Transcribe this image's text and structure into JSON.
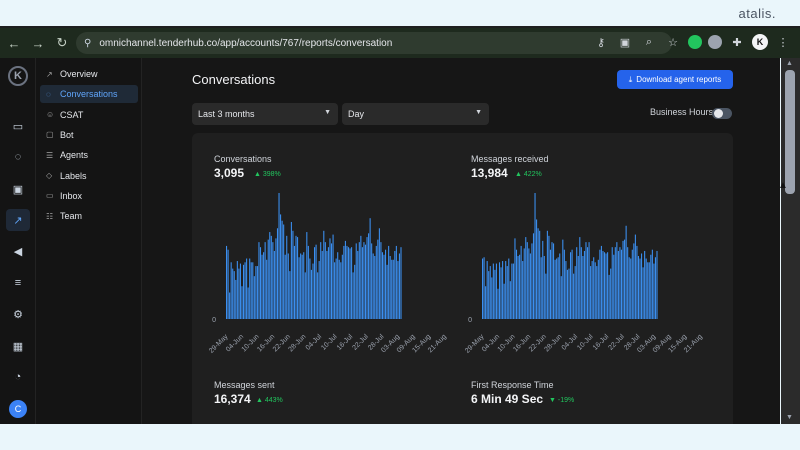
{
  "browser": {
    "brand_text": "atalis.",
    "url": "omnichannel.tenderhub.co/app/accounts/767/reports/conversation",
    "avatar_letter": "K"
  },
  "rail": {
    "logo_letter": "K",
    "avatar_letter": "C",
    "items": [
      {
        "name": "inbox-icon",
        "glyph": "▭"
      },
      {
        "name": "chat-icon",
        "glyph": "◌"
      },
      {
        "name": "contacts-icon",
        "glyph": "▣"
      },
      {
        "name": "reports-icon",
        "glyph": "↗"
      },
      {
        "name": "campaigns-icon",
        "glyph": "◀"
      },
      {
        "name": "library-icon",
        "glyph": "≡"
      },
      {
        "name": "settings-icon",
        "glyph": "⚙"
      },
      {
        "name": "integrations-icon",
        "glyph": "▦"
      },
      {
        "name": "notifications-icon",
        "glyph": "◔"
      }
    ]
  },
  "sidebar": {
    "items": [
      {
        "label": "Overview",
        "icon": "overview-icon",
        "glyph": "↗"
      },
      {
        "label": "Conversations",
        "icon": "conversations-icon",
        "glyph": "◌"
      },
      {
        "label": "CSAT",
        "icon": "csat-icon",
        "glyph": "☺"
      },
      {
        "label": "Bot",
        "icon": "bot-icon",
        "glyph": "▢"
      },
      {
        "label": "Agents",
        "icon": "agents-icon",
        "glyph": "☰"
      },
      {
        "label": "Labels",
        "icon": "labels-icon",
        "glyph": "◇"
      },
      {
        "label": "Inbox",
        "icon": "inbox-icon",
        "glyph": "▭"
      },
      {
        "label": "Team",
        "icon": "team-icon",
        "glyph": "☷"
      }
    ],
    "active_index": 1
  },
  "main": {
    "title": "Conversations",
    "download_label": "Download agent reports",
    "range_select": "Last 3 months",
    "group_select": "Day",
    "business_hours_label": "Business Hours",
    "business_hours_on": false
  },
  "metrics": [
    {
      "title": "Conversations",
      "value": "3,095",
      "delta": "398%",
      "direction": "up"
    },
    {
      "title": "Messages received",
      "value": "13,984",
      "delta": "422%",
      "direction": "up"
    },
    {
      "title": "Messages sent",
      "value": "16,374",
      "delta": "443%",
      "direction": "up"
    },
    {
      "title": "First Response Time",
      "value": "6 Min 49 Sec",
      "delta": "-19%",
      "direction": "down"
    }
  ],
  "colors": {
    "accent": "#2563eb",
    "bar": "#3b8ff0",
    "positive": "#22c55e"
  },
  "chart_data": [
    {
      "type": "bar",
      "title": "Conversations",
      "x_tick_labels": [
        "29-May",
        "04-Jun",
        "10-Jun",
        "16-Jun",
        "22-Jun",
        "28-Jun",
        "04-Jul",
        "10-Jul",
        "16-Jul",
        "22-Jul",
        "28-Jul",
        "03-Aug",
        "09-Aug",
        "15-Aug",
        "21-Aug"
      ],
      "y_tick_labels": [
        "0"
      ],
      "values": [
        58,
        55,
        21,
        45,
        40,
        38,
        31,
        46,
        40,
        44,
        26,
        43,
        45,
        48,
        25,
        48,
        45,
        45,
        34,
        42,
        42,
        61,
        57,
        51,
        53,
        61,
        47,
        63,
        69,
        66,
        61,
        54,
        64,
        72,
        100,
        83,
        78,
        75,
        51,
        66,
        52,
        38,
        77,
        70,
        58,
        66,
        65,
        49,
        52,
        51,
        53,
        37,
        69,
        58,
        48,
        39,
        44,
        57,
        59,
        37,
        46,
        61,
        54,
        70,
        61,
        54,
        57,
        64,
        60,
        67,
        45,
        48,
        53,
        47,
        45,
        51,
        58,
        62,
        58,
        57,
        56,
        57,
        37,
        43,
        60,
        54,
        61,
        66,
        57,
        61,
        59,
        65,
        68,
        80,
        60,
        52,
        50,
        58,
        63,
        72,
        61,
        53,
        51,
        55,
        43,
        58,
        50,
        47,
        47,
        54,
        58,
        46,
        52,
        57
      ],
      "ylim": [
        0,
        100
      ]
    },
    {
      "type": "bar",
      "title": "Messages received",
      "x_tick_labels": [
        "29-May",
        "04-Jun",
        "10-Jun",
        "16-Jun",
        "22-Jun",
        "28-Jun",
        "04-Jul",
        "10-Jul",
        "16-Jul",
        "22-Jul",
        "28-Jul",
        "03-Aug",
        "09-Aug",
        "15-Aug",
        "21-Aug"
      ],
      "y_tick_labels": [
        "0"
      ],
      "values": [
        48,
        49,
        26,
        46,
        38,
        42,
        33,
        44,
        39,
        44,
        24,
        45,
        41,
        46,
        28,
        46,
        42,
        48,
        30,
        44,
        44,
        64,
        55,
        50,
        51,
        58,
        46,
        56,
        65,
        61,
        56,
        52,
        60,
        68,
        100,
        79,
        72,
        70,
        49,
        62,
        50,
        36,
        70,
        66,
        55,
        61,
        60,
        47,
        48,
        49,
        52,
        34,
        63,
        55,
        46,
        39,
        40,
        53,
        55,
        36,
        42,
        57,
        50,
        65,
        57,
        50,
        54,
        61,
        57,
        61,
        42,
        46,
        49,
        45,
        42,
        47,
        55,
        58,
        54,
        53,
        52,
        53,
        35,
        40,
        57,
        51,
        57,
        61,
        54,
        57,
        55,
        62,
        63,
        74,
        57,
        49,
        48,
        55,
        60,
        67,
        58,
        50,
        48,
        52,
        41,
        54,
        48,
        45,
        45,
        51,
        55,
        44,
        49,
        54
      ],
      "ylim": [
        0,
        100
      ]
    }
  ]
}
